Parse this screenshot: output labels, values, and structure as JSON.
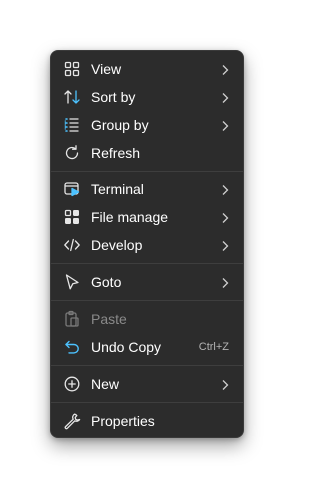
{
  "context_menu": {
    "items": [
      {
        "label": "View",
        "icon": "grid-icon",
        "has_submenu": true
      },
      {
        "label": "Sort by",
        "icon": "sort-arrows-icon",
        "has_submenu": true
      },
      {
        "label": "Group by",
        "icon": "list-group-icon",
        "has_submenu": true
      },
      {
        "label": "Refresh",
        "icon": "refresh-icon",
        "has_submenu": false
      },
      {
        "label": "Terminal",
        "icon": "terminal-icon",
        "has_submenu": true
      },
      {
        "label": "File manage",
        "icon": "apps-icon",
        "has_submenu": true
      },
      {
        "label": "Develop",
        "icon": "code-icon",
        "has_submenu": true
      },
      {
        "label": "Goto",
        "icon": "pointer-icon",
        "has_submenu": true
      },
      {
        "label": "Paste",
        "icon": "clipboard-icon",
        "has_submenu": false,
        "disabled": true
      },
      {
        "label": "Undo Copy",
        "icon": "undo-icon",
        "has_submenu": false,
        "shortcut": "Ctrl+Z"
      },
      {
        "label": "New",
        "icon": "plus-circle-icon",
        "has_submenu": true
      },
      {
        "label": "Properties",
        "icon": "wrench-icon",
        "has_submenu": false
      }
    ]
  },
  "colors": {
    "menu_background": "#2c2c2c",
    "text": "#ffffff",
    "disabled_text": "#8a8a8a",
    "accent": "#4cc2ff",
    "separator": "#3e3e3e"
  }
}
